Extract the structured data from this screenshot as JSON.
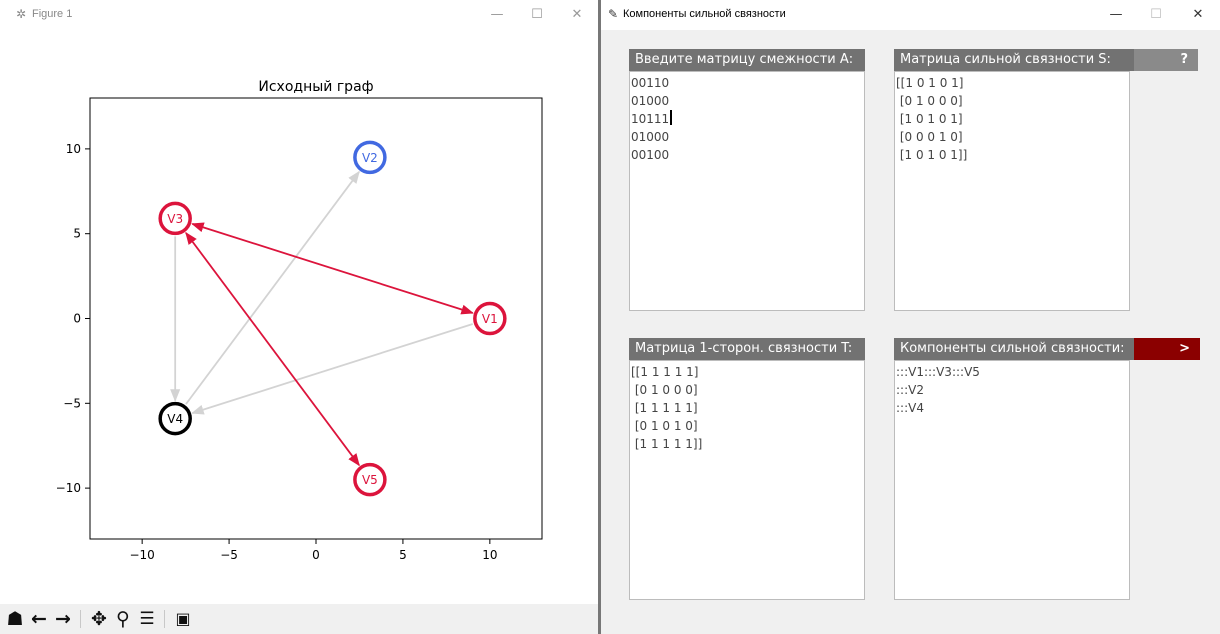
{
  "figure_window": {
    "title": "Figure 1",
    "controls": {
      "minimize": "—",
      "maximize": "☐",
      "close": "✕"
    },
    "toolbar": [
      "home-icon",
      "back-icon",
      "forward-icon",
      "pan-icon",
      "zoom-icon",
      "configure-icon",
      "save-icon"
    ]
  },
  "chart_data": {
    "type": "scatter",
    "title": "Исходный граф",
    "xlim": [
      -13,
      13
    ],
    "ylim": [
      -13,
      13
    ],
    "xticks": [
      -10,
      -5,
      0,
      5,
      10
    ],
    "yticks": [
      10,
      5,
      0,
      -5,
      -10
    ],
    "tick_labels_x": [
      "−10",
      "−5",
      "0",
      "5",
      "10"
    ],
    "tick_labels_y": [
      "10",
      "5",
      "0",
      "−5",
      "−10"
    ],
    "grid": false,
    "nodes": [
      {
        "id": "V1",
        "label": "V1",
        "x": 10,
        "y": 0,
        "color": "#dc143c"
      },
      {
        "id": "V2",
        "label": "V2",
        "x": 3.1,
        "y": 9.5,
        "color": "#4169e1"
      },
      {
        "id": "V3",
        "label": "V3",
        "x": -8.1,
        "y": 5.9,
        "color": "#dc143c"
      },
      {
        "id": "V4",
        "label": "V4",
        "x": -8.1,
        "y": -5.9,
        "color": "#000000"
      },
      {
        "id": "V5",
        "label": "V5",
        "x": 3.1,
        "y": -9.5,
        "color": "#dc143c"
      }
    ],
    "edges": [
      {
        "from": "V1",
        "to": "V4",
        "color": "#d3d3d3",
        "both": false
      },
      {
        "from": "V4",
        "to": "V2",
        "color": "#d3d3d3",
        "both": false
      },
      {
        "from": "V3",
        "to": "V4",
        "color": "#d3d3d3",
        "both": false
      },
      {
        "from": "V1",
        "to": "V3",
        "color": "#dc143c",
        "both": true
      },
      {
        "from": "V3",
        "to": "V5",
        "color": "#dc143c",
        "both": true
      }
    ]
  },
  "app_window": {
    "title": "Компоненты сильной связности",
    "controls": {
      "minimize": "—",
      "maximize": "☐",
      "close": "✕"
    },
    "panel_adjacency": {
      "header": "Введите матрицу смежности А:",
      "lines": [
        "00110",
        "01000",
        "10111",
        "01000",
        "00100"
      ]
    },
    "panel_strong": {
      "header": "Матрица сильной связности S:",
      "button": "?",
      "lines": [
        "[[1 0 1 0 1]",
        " [0 1 0 0 0]",
        " [1 0 1 0 1]",
        " [0 0 0 1 0]",
        " [1 0 1 0 1]]"
      ]
    },
    "panel_oneway": {
      "header": "Матрица 1-сторон. связности T:",
      "lines": [
        "[[1 1 1 1 1]",
        " [0 1 0 0 0]",
        " [1 1 1 1 1]",
        " [0 1 0 1 0]",
        " [1 1 1 1 1]]"
      ]
    },
    "panel_components": {
      "header": "Компоненты сильной связности:",
      "button": ">",
      "lines": [
        ":::V1:::V3:::V5",
        ":::V2",
        ":::V4"
      ]
    },
    "colors": {
      "header_bg": "#727272",
      "help_button_bg": "#8a8a8a",
      "run_button_bg": "#8b0000",
      "text": "#444444"
    }
  }
}
